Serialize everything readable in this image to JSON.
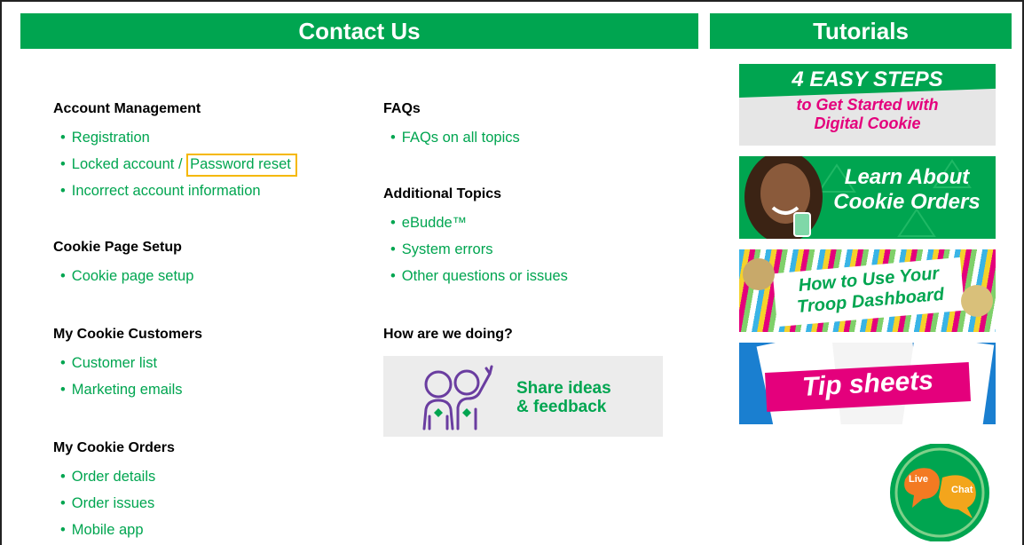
{
  "contact_title": "Contact Us",
  "tutorials_title": "Tutorials",
  "left_col": [
    {
      "heading": "Account Management",
      "items": [
        "Registration",
        "Locked account / ",
        "Incorrect account information"
      ],
      "highlight": "Password reset"
    },
    {
      "heading": "Cookie Page Setup",
      "items": [
        "Cookie page setup"
      ]
    },
    {
      "heading": "My Cookie Customers",
      "items": [
        "Customer list",
        "Marketing emails"
      ]
    },
    {
      "heading": "My Cookie Orders",
      "items": [
        "Order details",
        "Order issues",
        "Mobile app"
      ]
    }
  ],
  "right_col": [
    {
      "heading": "FAQs",
      "items": [
        "FAQs on all topics"
      ]
    },
    {
      "heading": "Additional Topics",
      "items": [
        "eBudde™",
        "System errors",
        "Other questions or issues"
      ]
    },
    {
      "heading": "How are we doing?",
      "items": []
    }
  ],
  "feedback": {
    "line1": "Share ideas",
    "line2": "& feedback"
  },
  "tutorials": {
    "t1": {
      "line1": "4 EASY STEPS",
      "line2": "to Get Started with",
      "line3": "Digital Cookie"
    },
    "t2": {
      "line1": "Learn About",
      "line2": "Cookie Orders"
    },
    "t3": {
      "line1": "How to Use Your",
      "line2": "Troop Dashboard"
    },
    "t4": {
      "line1": "Tip sheets"
    }
  },
  "chat": {
    "live": "Live",
    "chat": "Chat"
  },
  "colors": {
    "green": "#00a550",
    "highlight": "#f5b800",
    "magenta": "#e4007c"
  }
}
